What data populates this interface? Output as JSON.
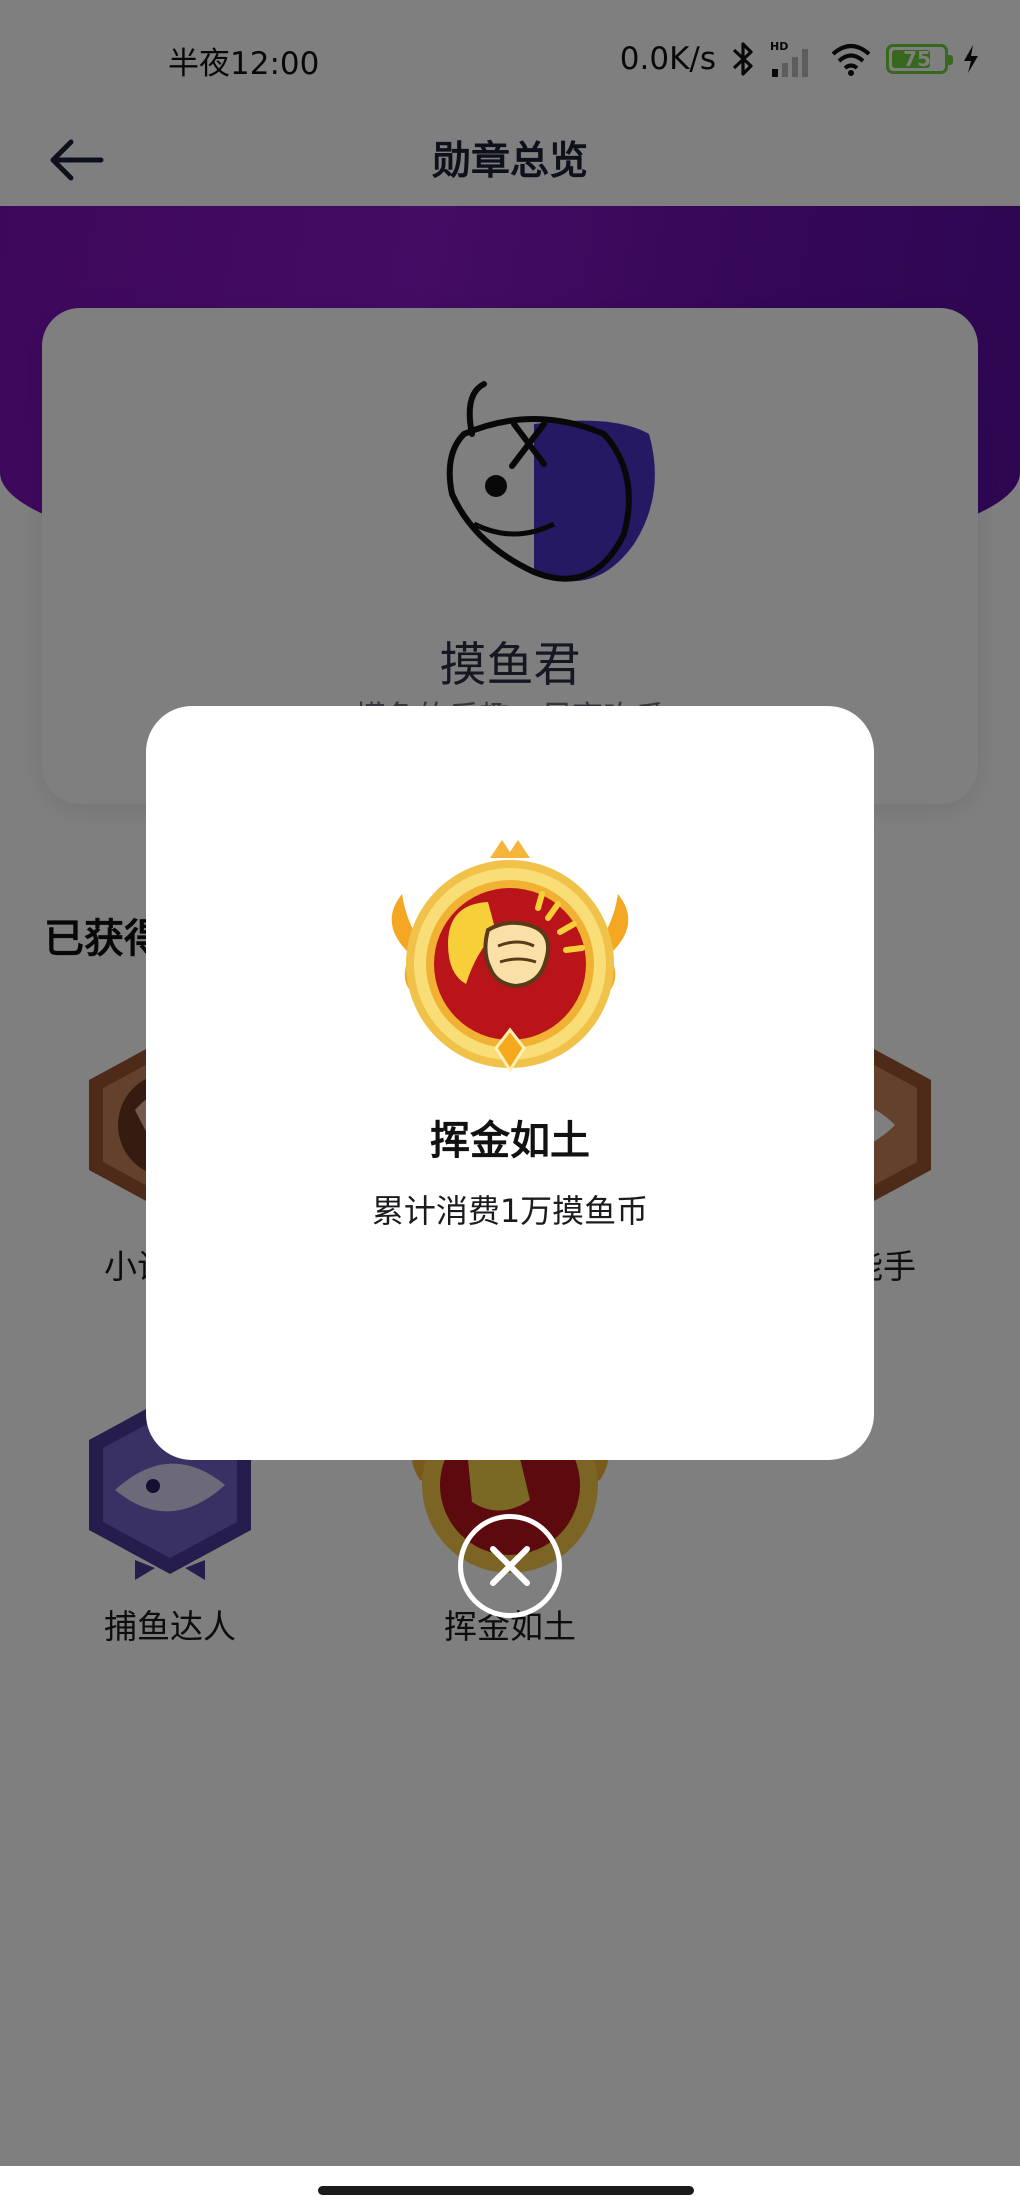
{
  "status_bar": {
    "time": "半夜12:00",
    "net_speed": "0.0K/s",
    "hd_label": "HD",
    "battery_level": 75,
    "battery_text": "75"
  },
  "header": {
    "title": "勋章总览",
    "back_icon": "arrow-left-icon"
  },
  "hero": {
    "badge_name": "摸鱼君",
    "badge_desc": "摸鱼的乐趣，尽享吃瓜"
  },
  "earned": {
    "title": "已获得",
    "badges": [
      {
        "label": "小试牛刀",
        "icon": "bronze-hexagon-badge-icon"
      },
      {
        "label": "摸鱼能手",
        "icon": "bronze-fish-badge-icon"
      },
      {
        "label": "捕鱼达人",
        "icon": "purple-fish-badge-icon"
      },
      {
        "label": "挥金如土",
        "icon": "gold-coin-badge-icon"
      }
    ]
  },
  "dialog": {
    "title": "挥金如土",
    "description": "累计消费1万摸鱼币",
    "close_icon": "close-circle-icon"
  },
  "colors": {
    "accent_purple": "#7b10b8",
    "badge_red": "#b8141a",
    "badge_gold": "#f2b534",
    "battery_green": "#6fd13b"
  }
}
